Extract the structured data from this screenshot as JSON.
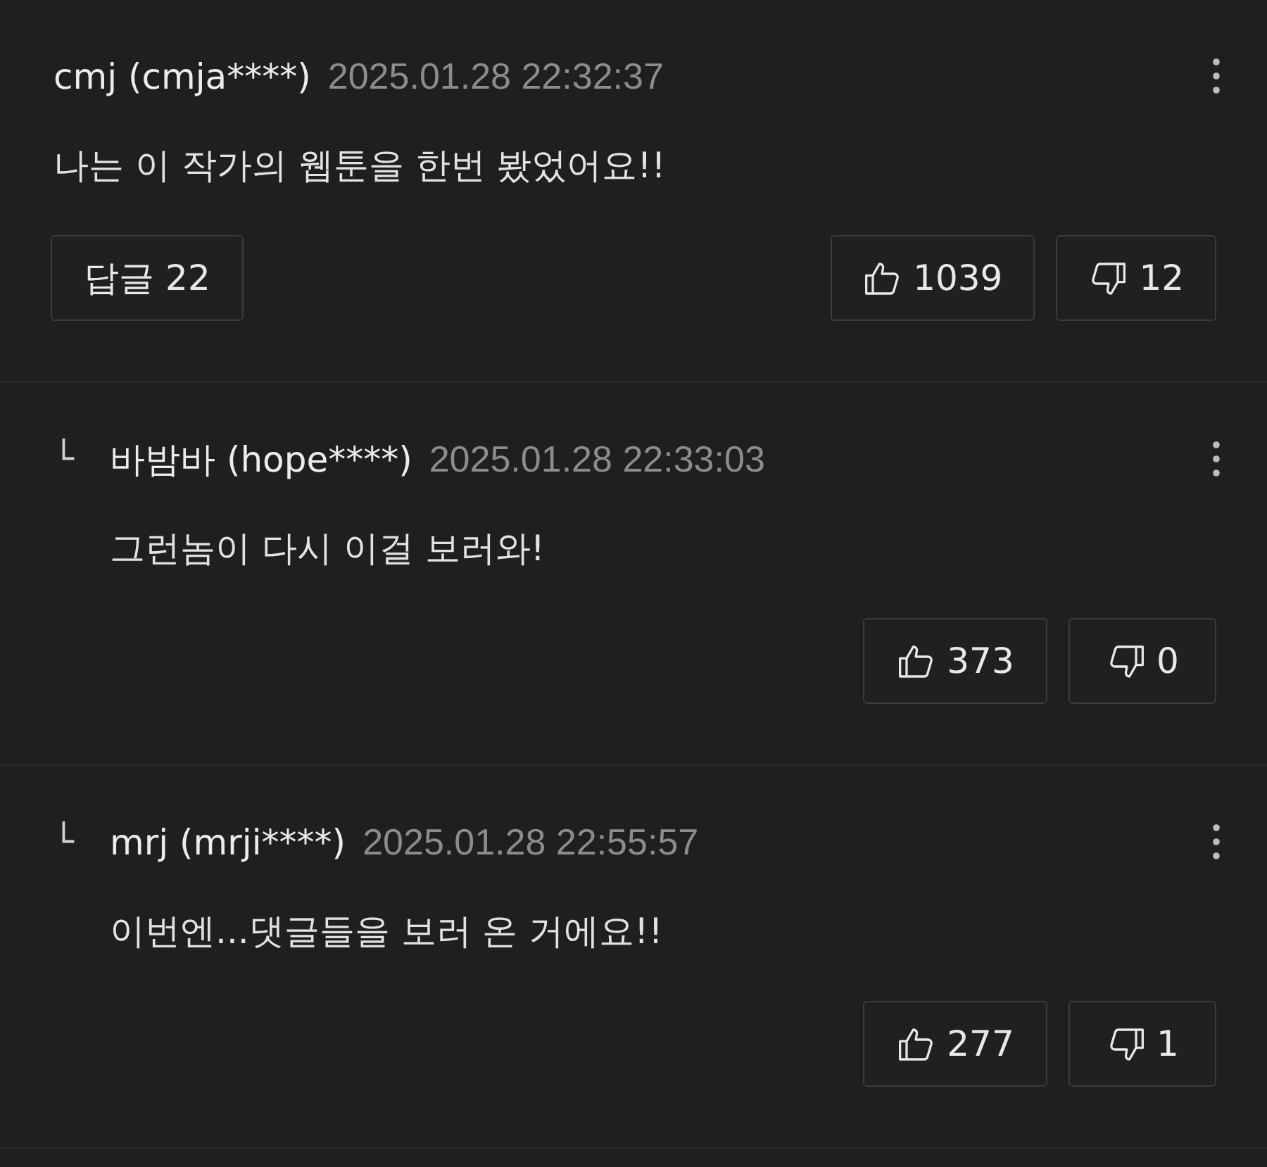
{
  "comments": [
    {
      "kind": "comment",
      "author": "cmj (cmja****)",
      "time": "2025.01.28 22:32:37",
      "text": "나는 이 작가의 웹툰을 한번 봤었어요!!",
      "replies_button": "답글 22",
      "likes": "1039",
      "dislikes": "12"
    },
    {
      "kind": "reply",
      "marker": "└",
      "author": "바밤바 (hope****)",
      "time": "2025.01.28 22:33:03",
      "text": "그런놈이 다시 이걸 보러와!",
      "likes": "373",
      "dislikes": "0"
    },
    {
      "kind": "reply",
      "marker": "└",
      "author": "mrj (mrji****)",
      "time": "2025.01.28 22:55:57",
      "text": "이번엔...댓글들을 보러 온 거에요!!",
      "likes": "277",
      "dislikes": "1"
    }
  ]
}
